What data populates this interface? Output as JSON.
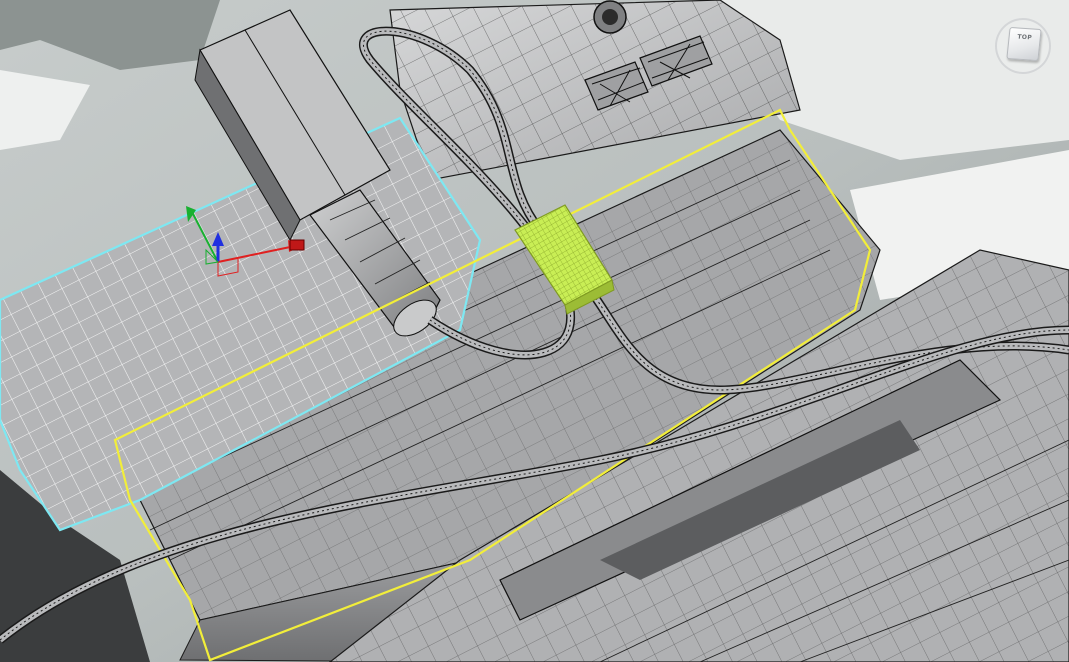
{
  "viewcube": {
    "face_label": "TOP"
  },
  "colors": {
    "background_light": "#d9dcd9",
    "background_dark": "#2a2c2e",
    "mesh_fill": "#8e8f90",
    "mesh_face_light": "#c4c5c6",
    "mesh_face_mid": "#a3a4a6",
    "wire": "#1a1a1a",
    "selection_cyan": "#7ee8f2",
    "selection_yellow": "#f2ee3a",
    "highlight_green": "#c9ee55",
    "gizmo_x": "#e02020",
    "gizmo_y": "#18b030",
    "gizmo_z": "#2030e0"
  },
  "scene": {
    "objects": [
      "camera-body-mesh",
      "side-block-mesh",
      "connector-plug-mesh",
      "cable-loop",
      "cable-lower",
      "cable-clip",
      "lower-frame-mesh"
    ],
    "gizmo": "transform-gizmo"
  }
}
